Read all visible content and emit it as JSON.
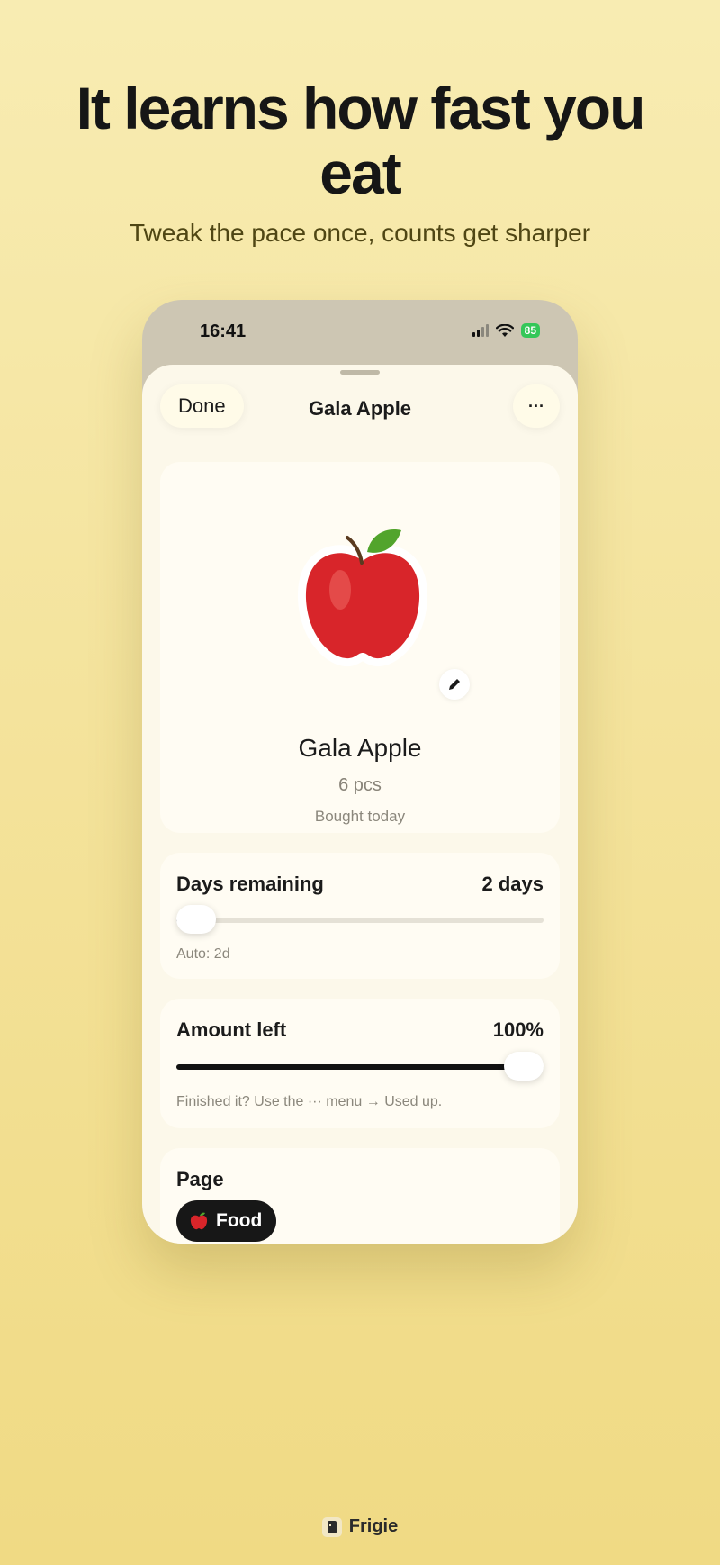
{
  "headline": "It learns how fast you eat",
  "subhead": "Tweak the pace once, counts get sharper",
  "status_bar": {
    "time": "16:41",
    "battery": "85"
  },
  "sheet": {
    "done_label": "Done",
    "title": "Gala Apple",
    "more_label": "···"
  },
  "item": {
    "icon": "red-apple",
    "name": "Gala Apple",
    "quantity": "6 pcs",
    "bought": "Bought today"
  },
  "days_remaining": {
    "label": "Days remaining",
    "value": "2 days",
    "level": 0.04,
    "note": "Auto: 2d"
  },
  "amount_left": {
    "label": "Amount left",
    "value": "100%",
    "level": 1.0,
    "note": "Finished it? Use the ··· menu → Used up."
  },
  "page_section": {
    "label": "Page",
    "chip_icon": "red-apple",
    "chip_label": "Food"
  },
  "brand": {
    "name": "Frigie"
  },
  "colors": {
    "background": "#f4e39c",
    "accent": "#171717",
    "sheet": "#fcf8ea",
    "battery": "#34c759"
  }
}
